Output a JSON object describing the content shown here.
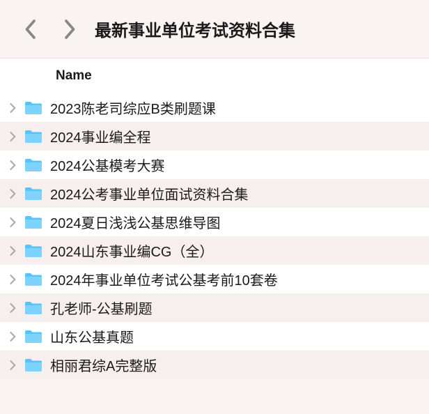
{
  "header": {
    "title": "最新事业单位考试资料合集"
  },
  "columns": {
    "name": "Name"
  },
  "rows": [
    {
      "label": "2023陈老司综应B类刷题课"
    },
    {
      "label": "2024事业编全程"
    },
    {
      "label": "2024公基模考大赛"
    },
    {
      "label": "2024公考事业单位面试资料合集"
    },
    {
      "label": "2024夏日浅浅公基思维导图"
    },
    {
      "label": "2024山东事业编CG（全）"
    },
    {
      "label": "2024年事业单位考试公基考前10套卷"
    },
    {
      "label": "孔老师-公基刷题"
    },
    {
      "label": "山东公基真题"
    },
    {
      "label": "相丽君综A完整版"
    }
  ]
}
